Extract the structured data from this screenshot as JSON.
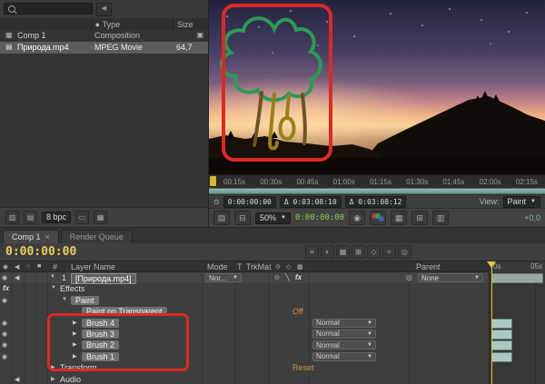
{
  "colors": {
    "annotation_red": "#da2a26",
    "work_area_teal": "#7fae a4",
    "brush_bar_teal": "#abc9c1",
    "timecode_yellow": "#e8cf5e",
    "value_orange": "#d08f3e",
    "viewer_timecode_green": "#8fc45a",
    "offset_teal": "#6fbfae"
  },
  "icons": {
    "collapse_left": "◀",
    "type_diamond": "◆",
    "comp_item": "▦",
    "footage_item": "▤",
    "comp_badge": "▣",
    "eye": "◉",
    "speaker": "◀",
    "solo": "○",
    "lock": "■",
    "arrow_down": "▼",
    "arrow_right": "▶",
    "dropdown_caret": "▼",
    "pickwhip": "◎",
    "fx": "fx",
    "slash": "╲",
    "switch_dot": "⊙",
    "close": "×",
    "clock": "⊙",
    "footer_tools": [
      "▥",
      "▤",
      "▭",
      "▦"
    ],
    "tl_tools": [
      "≡",
      "◐",
      "▦",
      "⊞",
      "◇",
      "≈",
      "◎"
    ],
    "switch_header": [
      "⊙",
      "◇",
      "▦"
    ],
    "viewer_tools_left": [
      "▤",
      "⊟"
    ],
    "viewer_tools_right": [
      "◉",
      "▦",
      "⊞",
      "▥"
    ]
  },
  "project_panel": {
    "search": {
      "placeholder": ""
    },
    "columns": {
      "type_label": "Type",
      "size_label": "Size"
    },
    "items": [
      {
        "name": "Comp 1",
        "type": "Composition",
        "size": ""
      },
      {
        "name": "Природа.mp4",
        "type": "MPEG Movie",
        "size": "64,7"
      }
    ],
    "footer": {
      "bpc_label": "8 bpc"
    }
  },
  "viewer": {
    "ruler_times": [
      "00:15s",
      "00:30s",
      "00:45s",
      "01:00s",
      "01:15s",
      "01:30s",
      "01:45s",
      "02:00s",
      "02:15s"
    ],
    "info": {
      "current_time": "0:00:00:00",
      "delta_in": "Δ 0:03:08:10",
      "delta_out": "Δ 0:03:08:12",
      "view_label": "View:",
      "view_value": "Paint"
    },
    "toolbar": {
      "zoom_value": "50%",
      "timecode": "0:00:00:00",
      "offset_value": "+0,0"
    }
  },
  "timeline": {
    "tabs": [
      {
        "label": "Comp 1"
      },
      {
        "label": "Render Queue"
      }
    ],
    "timecode": "0:00:00:00",
    "columns": {
      "index": "#",
      "layer_name": "Layer Name",
      "mode": "Mode",
      "t": "T",
      "trkmat": "TrkMat",
      "parent": "Parent"
    },
    "layer": {
      "index": "1",
      "name": "[Природа.mp4]",
      "mode": "Nor...",
      "parent_value": "None"
    },
    "rows": [
      {
        "label": "Effects",
        "value": ""
      },
      {
        "label": "Paint",
        "value": ""
      },
      {
        "label": "Paint on Transparent",
        "value": "Off"
      },
      {
        "label": "Brush 4",
        "value": "Normal"
      },
      {
        "label": "Brush 3",
        "value": "Normal"
      },
      {
        "label": "Brush 2",
        "value": "Normal"
      },
      {
        "label": "Brush 1",
        "value": "Normal"
      },
      {
        "label": "Transform",
        "value": "Reset"
      },
      {
        "label": "Audio",
        "value": ""
      }
    ],
    "ruler": {
      "start_label": "0s",
      "end_label": "05s"
    }
  }
}
